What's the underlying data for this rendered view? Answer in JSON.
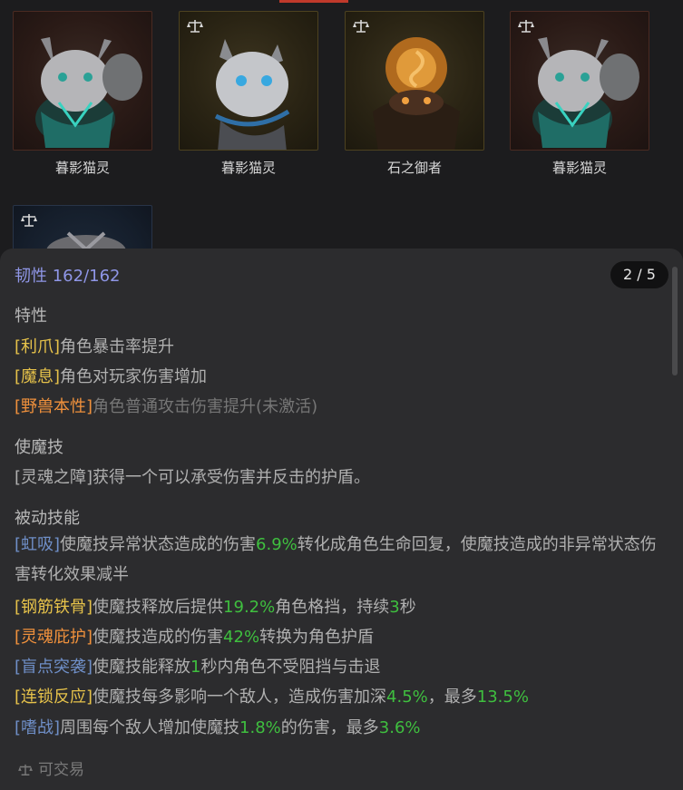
{
  "cards": [
    {
      "name": "暮影猫灵",
      "style": "red",
      "tradable_icon": false
    },
    {
      "name": "暮影猫灵",
      "style": "gold",
      "tradable_icon": true
    },
    {
      "name": "石之御者",
      "style": "gold",
      "tradable_icon": true
    },
    {
      "name": "暮影猫灵",
      "style": "red",
      "tradable_icon": true
    },
    {
      "name": "",
      "style": "blue",
      "tradable_icon": true
    }
  ],
  "panel": {
    "page_indicator": "2 / 5",
    "toughness": "韧性 162/162",
    "traits": {
      "title": "特性",
      "items": [
        {
          "tag": "[利爪]",
          "text": "角色暴击率提升"
        },
        {
          "tag": "[魔息]",
          "text": "角色对玩家伤害增加"
        },
        {
          "tag": "[野兽本性]",
          "text": "角色普通攻击伤害提升(未激活)"
        }
      ]
    },
    "skill": {
      "title": "使魔技",
      "text": "[灵魂之障]获得一个可以承受伤害并反击的护盾。"
    },
    "passives": {
      "title": "被动技能",
      "items": [
        {
          "tag": "[虹吸]",
          "parts": [
            "使魔技异常状态造成的伤害",
            "6.9%",
            "转化成角色生命回复，使魔技造成的非异常状态伤害转化效果减半"
          ]
        },
        {
          "tag": "[钢筋铁骨]",
          "parts": [
            "使魔技释放后提供",
            "19.2%",
            "角色格挡，持续",
            "3",
            "秒"
          ]
        },
        {
          "tag": "[灵魂庇护]",
          "parts": [
            "使魔技造成的伤害",
            "42%",
            "转换为角色护盾"
          ]
        },
        {
          "tag": "[盲点突袭]",
          "parts": [
            "使魔技能释放",
            "1",
            "秒内角色不受阻挡与击退"
          ]
        },
        {
          "tag": "[连锁反应]",
          "parts": [
            "使魔技每多影响一个敌人，造成伤害加深",
            "4.5%",
            "，最多",
            "13.5%"
          ]
        },
        {
          "tag": "[嗜战]",
          "parts": [
            "周围每个敌人增加使魔技",
            "1.8%",
            "的伤害，最多",
            "3.6%"
          ]
        }
      ]
    },
    "tradable_label": "可交易"
  },
  "colors": {
    "gold_tag": "#e6c24a",
    "orange_tag": "#f0913c",
    "blue_tag": "#6f8fc8",
    "highlight_green": "#3fbf3f",
    "toughness": "#8f96e6"
  }
}
